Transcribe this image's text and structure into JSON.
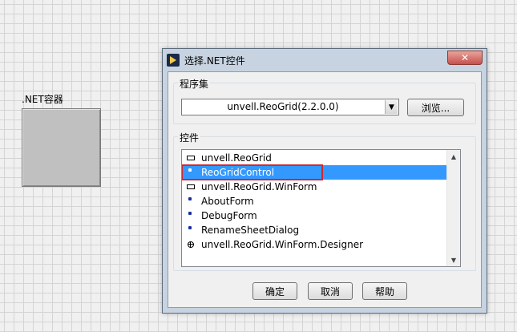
{
  "canvas": {
    "container_label": ".NET容器"
  },
  "dialog": {
    "title": "选择.NET控件",
    "close_glyph": "✕",
    "assembly_group_label": "程序集",
    "assembly_value": "unvell.ReoGrid(2.2.0.0)",
    "browse_label": "浏览...",
    "control_group_label": "控件",
    "items": [
      {
        "label": "unvell.ReoGrid",
        "icon": "namespace-icon"
      },
      {
        "label": "ReoGridControl",
        "icon": "class-icon"
      },
      {
        "label": "unvell.ReoGrid.WinForm",
        "icon": "namespace-icon"
      },
      {
        "label": "AboutForm",
        "icon": "class-icon"
      },
      {
        "label": "DebugForm",
        "icon": "class-icon"
      },
      {
        "label": "RenameSheetDialog",
        "icon": "class-icon"
      },
      {
        "label": "unvell.ReoGrid.WinForm.Designer",
        "icon": "expand-plus-icon"
      }
    ],
    "selected_index": 1,
    "ok_label": "确定",
    "cancel_label": "取消",
    "help_label": "帮助"
  },
  "colors": {
    "selection": "#3399ff",
    "highlight_box": "#d2272e",
    "close_button": "#c75050"
  }
}
